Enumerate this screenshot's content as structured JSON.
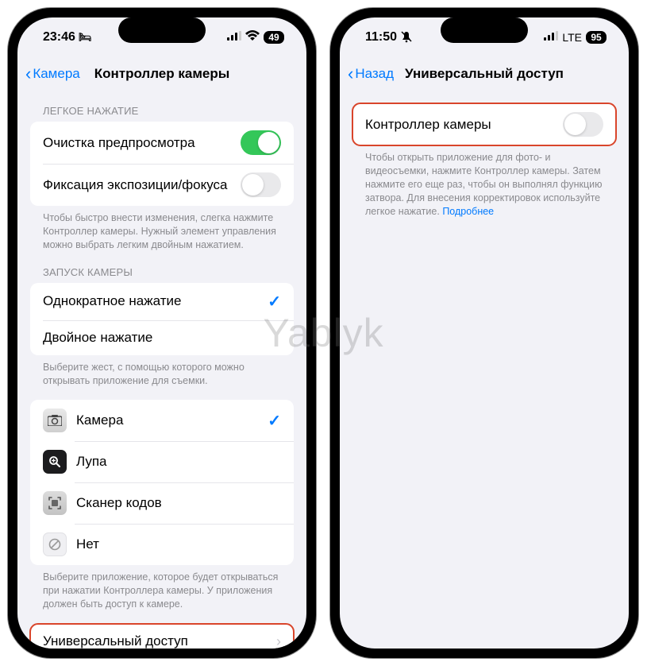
{
  "watermark": "Yablyk",
  "left": {
    "status": {
      "time": "23:46",
      "battery": "49",
      "icons": {
        "bed": "🛏",
        "signal": "signal-icon",
        "wifi": "wifi-icon"
      }
    },
    "nav": {
      "back": "Камера",
      "title": "Контроллер камеры"
    },
    "sections": {
      "light_press": {
        "header": "ЛЕГКОЕ НАЖАТИЕ",
        "rows": [
          {
            "label": "Очистка предпросмотра",
            "toggle": true
          },
          {
            "label": "Фиксация экспозиции/фокуса",
            "toggle": false
          }
        ],
        "footer": "Чтобы быстро внести изменения, слегка нажмите Контроллер камеры. Нужный элемент управления можно выбрать легким двойным нажатием."
      },
      "launch": {
        "header": "ЗАПУСК КАМЕРЫ",
        "rows": [
          {
            "label": "Однократное нажатие",
            "checked": true
          },
          {
            "label": "Двойное нажатие",
            "checked": false
          }
        ],
        "footer": "Выберите жест, с помощью которого можно открывать приложение для съемки."
      },
      "apps": {
        "rows": [
          {
            "label": "Камера",
            "icon": "camera",
            "checked": true
          },
          {
            "label": "Лупа",
            "icon": "magnifier",
            "checked": false
          },
          {
            "label": "Сканер кодов",
            "icon": "scanner",
            "checked": false
          },
          {
            "label": "Нет",
            "icon": "none",
            "checked": false
          }
        ],
        "footer": "Выберите приложение, которое будет открываться при нажатии Контроллера камеры. У приложения должен быть доступ к камере."
      },
      "accessibility": {
        "label": "Универсальный доступ"
      }
    }
  },
  "right": {
    "status": {
      "time": "11:50",
      "battery": "95",
      "lte": "LTE",
      "icons": {
        "silent": "🔕",
        "signal": "signal-icon"
      }
    },
    "nav": {
      "back": "Назад",
      "title": "Универсальный доступ"
    },
    "row": {
      "label": "Контроллер камеры",
      "toggle": false
    },
    "footer": "Чтобы открыть приложение для фото- и видеосъемки, нажмите Контроллер камеры. Затем нажмите его еще раз, чтобы он выполнял функцию затвора. Для внесения корректировок используйте легкое нажатие.",
    "more": "Подробнее"
  }
}
